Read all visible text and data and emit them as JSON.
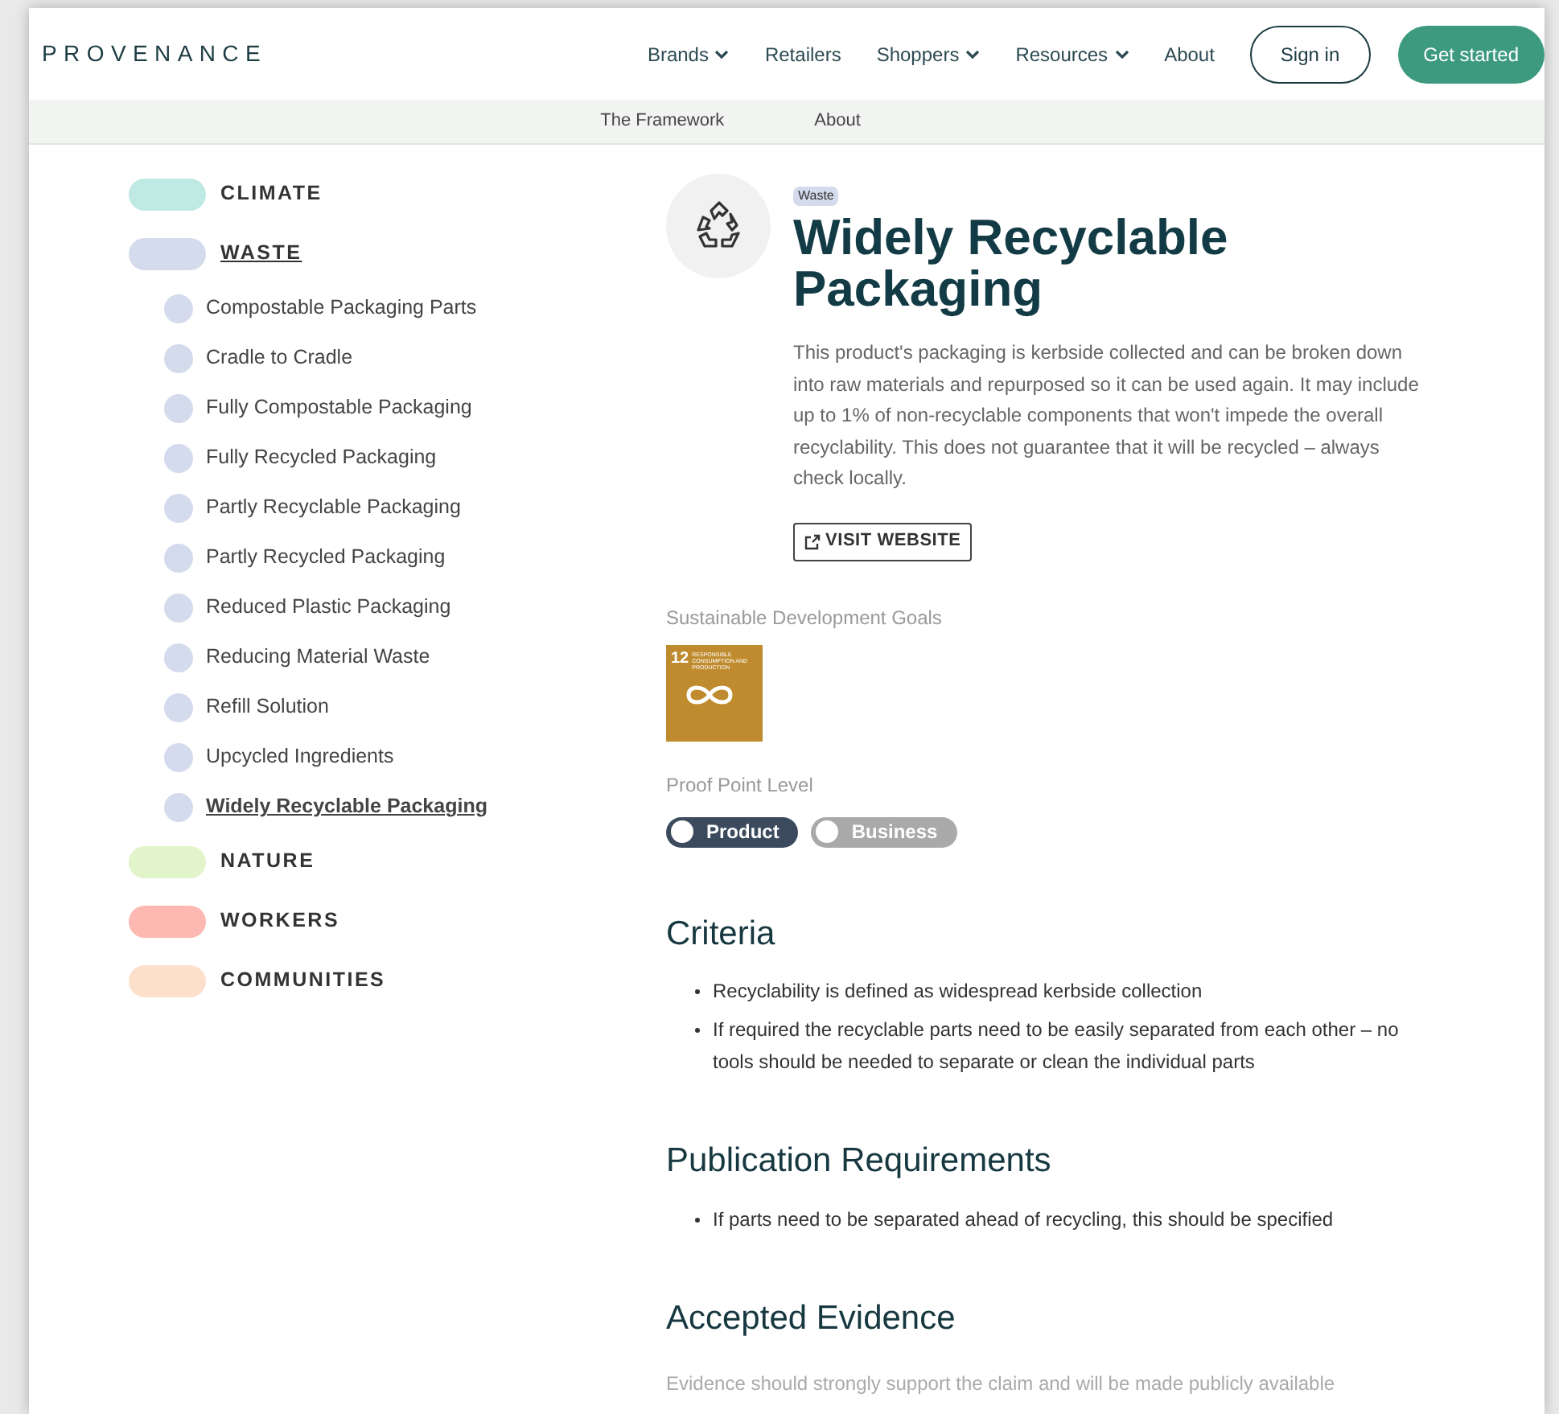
{
  "logo": "PROVENANCE",
  "nav": [
    {
      "label": "Brands",
      "dropdown": true
    },
    {
      "label": "Retailers",
      "dropdown": false
    },
    {
      "label": "Shoppers",
      "dropdown": true
    },
    {
      "label": "Resources",
      "dropdown": true
    },
    {
      "label": "About",
      "dropdown": false
    }
  ],
  "sign_in": "Sign in",
  "get_started": "Get started",
  "subnav": [
    "The Framework",
    "About"
  ],
  "categories": [
    {
      "label": "CLIMATE",
      "color": "#bfeae3",
      "selected": false
    },
    {
      "label": "WASTE",
      "color": "#d3dbec",
      "selected": true,
      "children": [
        {
          "label": "Compostable Packaging Parts",
          "selected": false
        },
        {
          "label": "Cradle to Cradle",
          "selected": false
        },
        {
          "label": "Fully Compostable Packaging",
          "selected": false
        },
        {
          "label": "Fully Recycled Packaging",
          "selected": false
        },
        {
          "label": "Partly Recyclable Packaging",
          "selected": false
        },
        {
          "label": "Partly Recycled Packaging",
          "selected": false
        },
        {
          "label": "Reduced Plastic Packaging",
          "selected": false
        },
        {
          "label": "Reducing Material Waste",
          "selected": false
        },
        {
          "label": "Refill Solution",
          "selected": false
        },
        {
          "label": "Upcycled Ingredients",
          "selected": false
        },
        {
          "label": "Widely Recyclable Packaging",
          "selected": true
        }
      ]
    },
    {
      "label": "NATURE",
      "color": "#e2f4c9",
      "selected": false
    },
    {
      "label": "WORKERS",
      "color": "#fdb9b1",
      "selected": false
    },
    {
      "label": "COMMUNITIES",
      "color": "#fde0cc",
      "selected": false
    }
  ],
  "tag": "Waste",
  "title": "Widely Recyclable Packaging",
  "description": "This product's packaging is kerbside collected and can be broken down into raw materials and repurposed so it can be used again. It may include up to 1% of non-recyclable components that won't impede the overall recyclability. This does not guarantee that it will be recycled – always check locally.",
  "visit_website": "VISIT WEBSITE",
  "sdg_heading": "Sustainable Development Goals",
  "sdg": {
    "number": "12",
    "label": "RESPONSIBLE CONSUMPTION AND PRODUCTION"
  },
  "level_heading": "Proof Point Level",
  "levels": [
    {
      "label": "Product",
      "selected": true
    },
    {
      "label": "Business",
      "selected": false
    }
  ],
  "sections": [
    {
      "heading": "Criteria",
      "bullets": [
        "Recyclability is defined as widespread kerbside collection",
        "If required the recyclable parts need to be easily separated from each other – no tools should be needed to separate or clean the individual parts"
      ]
    },
    {
      "heading": "Publication Requirements",
      "bullets": [
        "If parts need to be separated ahead of recycling, this should be specified"
      ]
    },
    {
      "heading": "Accepted Evidence",
      "text": "Evidence should strongly support the claim and will be made publicly available"
    }
  ]
}
